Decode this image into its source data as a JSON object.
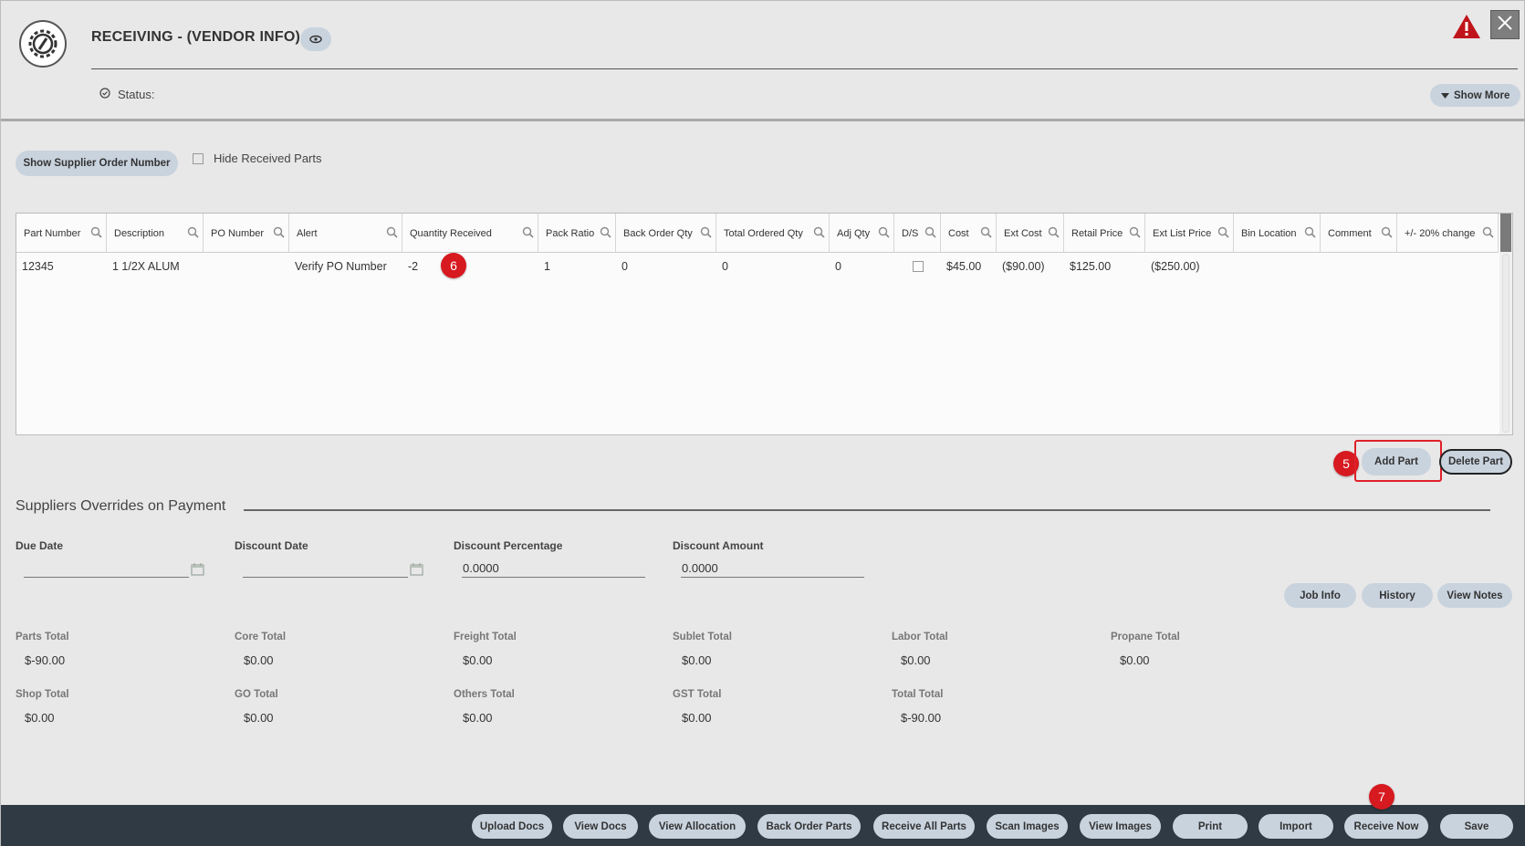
{
  "header": {
    "title": "RECEIVING -  (VENDOR INFO)",
    "status_label": "Status:",
    "show_more_label": "Show More"
  },
  "toolbar": {
    "show_supplier_order_label": "Show Supplier Order Number",
    "hide_received_label": "Hide Received Parts",
    "hide_received_checked": false
  },
  "grid": {
    "columns": [
      "Part Number",
      "Description",
      "PO Number",
      "Alert",
      "Quantity Received",
      "Pack Ratio",
      "Back Order Qty",
      "Total Ordered Qty",
      "Adj Qty",
      "D/S",
      "Cost",
      "Ext Cost",
      "Retail Price",
      "Ext List Price",
      "Bin Location",
      "Comment",
      "+/- 20% change"
    ],
    "rows": [
      {
        "part_number": "12345",
        "description": "1 1/2X ALUM",
        "po_number": "",
        "alert": "Verify PO Number",
        "quantity_received": "-2",
        "pack_ratio": "1",
        "back_order_qty": "0",
        "total_ordered_qty": "0",
        "adj_qty": "0",
        "ds_checked": false,
        "cost": "$45.00",
        "ext_cost": "($90.00)",
        "retail_price": "$125.00",
        "ext_list_price": "($250.00)",
        "bin_location": "",
        "comment": "",
        "change": ""
      }
    ]
  },
  "badges": {
    "quantity": "6",
    "add_part": "5",
    "receive_now": "7"
  },
  "part_actions": {
    "add_part_label": "Add Part",
    "delete_part_label": "Delete Part"
  },
  "overrides": {
    "section_title": "Suppliers Overrides on Payment",
    "due_date_label": "Due Date",
    "due_date_value": "",
    "discount_date_label": "Discount Date",
    "discount_date_value": "",
    "discount_percentage_label": "Discount Percentage",
    "discount_percentage_value": "0.0000",
    "discount_amount_label": "Discount Amount",
    "discount_amount_value": "0.0000"
  },
  "side_buttons": {
    "job_info": "Job Info",
    "history": "History",
    "view_notes": "View Notes"
  },
  "totals": {
    "parts_total_label": "Parts Total",
    "parts_total": "$-90.00",
    "core_total_label": "Core Total",
    "core_total": "$0.00",
    "freight_total_label": "Freight Total",
    "freight_total": "$0.00",
    "sublet_total_label": "Sublet Total",
    "sublet_total": "$0.00",
    "labor_total_label": "Labor Total",
    "labor_total": "$0.00",
    "propane_total_label": "Propane Total",
    "propane_total": "$0.00",
    "shop_total_label": "Shop Total",
    "shop_total": "$0.00",
    "go_total_label": "GO Total",
    "go_total": "$0.00",
    "others_total_label": "Others Total",
    "others_total": "$0.00",
    "gst_total_label": "GST Total",
    "gst_total": "$0.00",
    "total_total_label": "Total Total",
    "total_total": "$-90.00"
  },
  "footer": {
    "upload_docs": "Upload Docs",
    "view_docs": "View Docs",
    "view_allocation": "View Allocation",
    "back_order_parts": "Back Order Parts",
    "receive_all_parts": "Receive All Parts",
    "scan_images": "Scan Images",
    "view_images": "View Images",
    "print": "Print",
    "import": "Import",
    "receive_now": "Receive Now",
    "save": "Save"
  },
  "colors": {
    "accent_pill": "#c9d3de",
    "footer_bg": "#2f3a44",
    "badge_red": "#d71920",
    "warning_red": "#c0141b"
  },
  "icons": [
    "gear-logo-icon",
    "eye-icon",
    "warning-icon",
    "close-icon",
    "status-check-icon",
    "caret-down-icon",
    "search-icon",
    "calendar-icon"
  ]
}
